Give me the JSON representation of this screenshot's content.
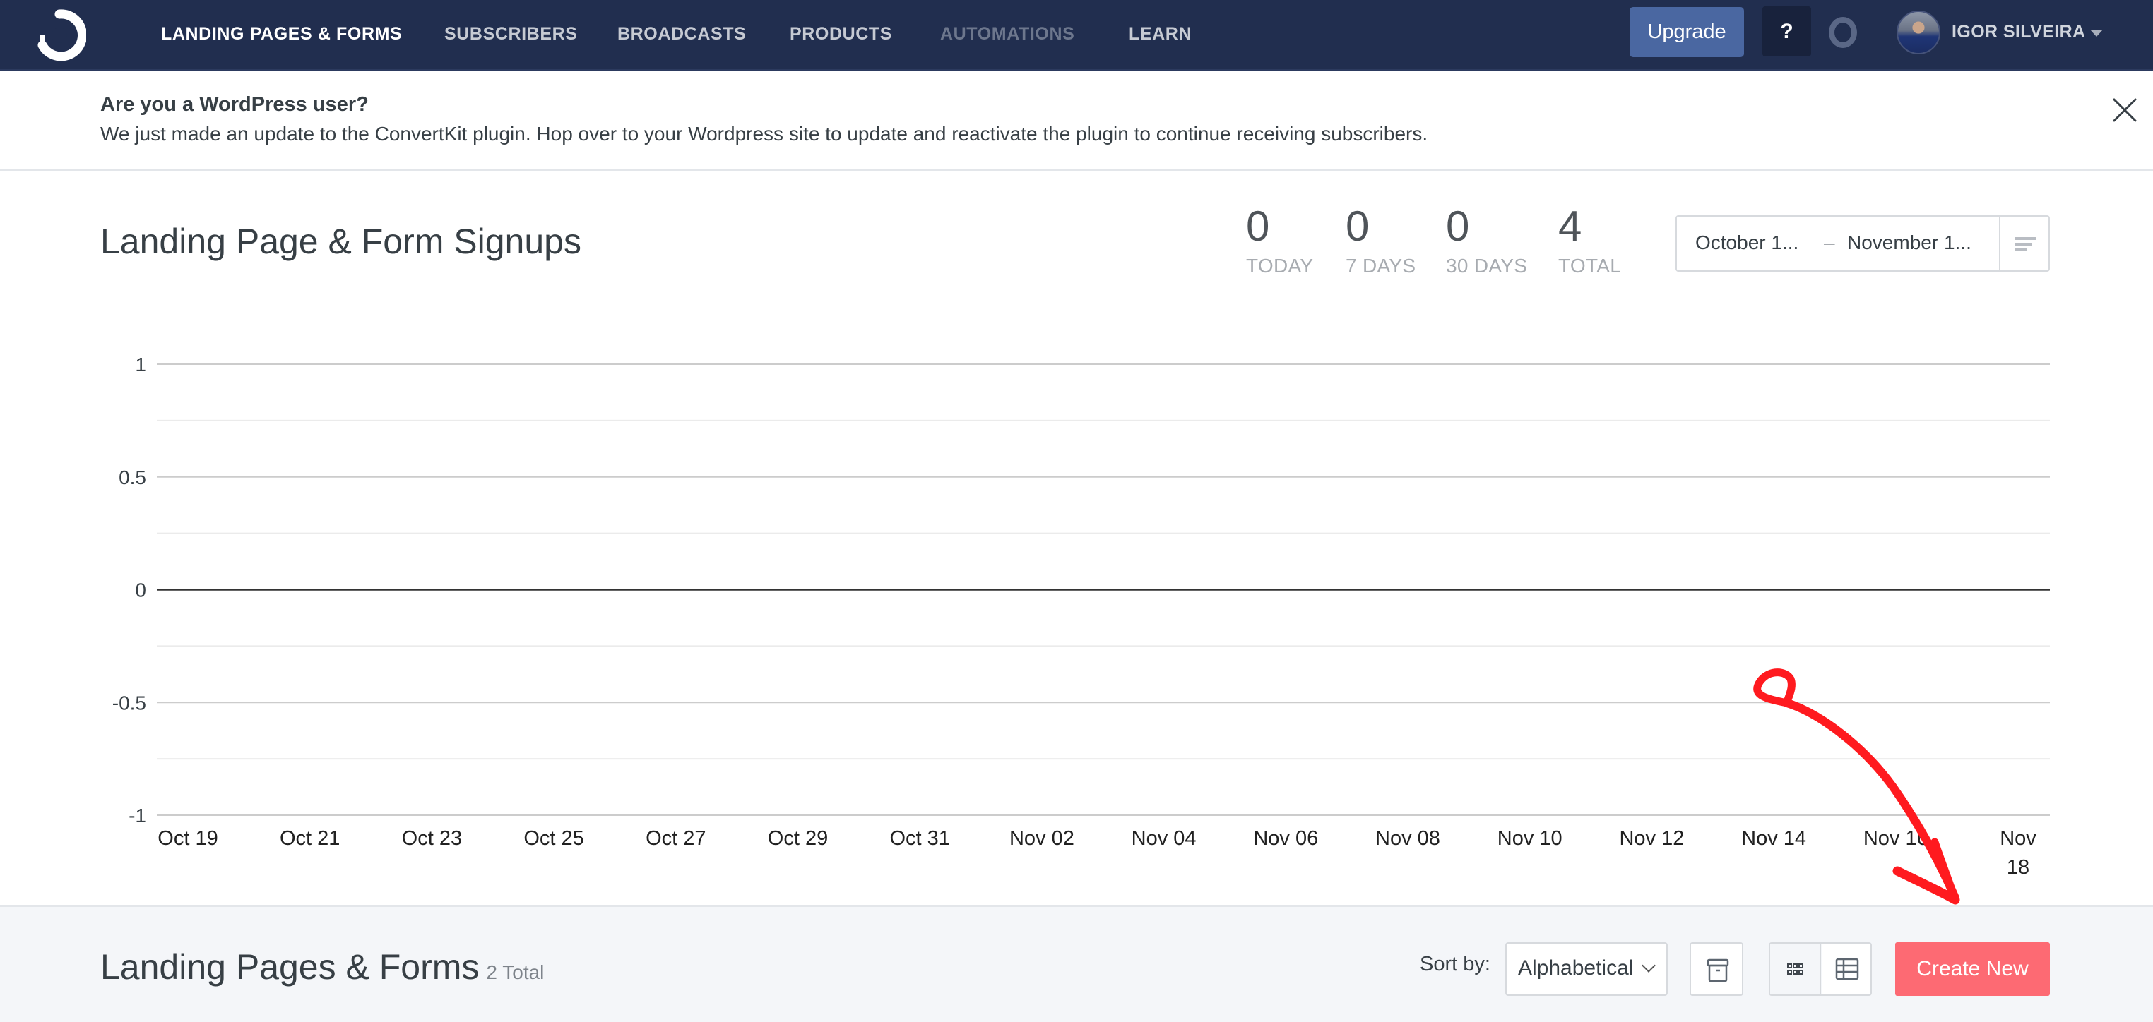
{
  "nav": {
    "logo_icon": "convertkit-logo-icon",
    "items": [
      {
        "label": "LANDING PAGES & FORMS",
        "state": "active"
      },
      {
        "label": "SUBSCRIBERS",
        "state": "normal"
      },
      {
        "label": "BROADCASTS",
        "state": "normal"
      },
      {
        "label": "PRODUCTS",
        "state": "normal"
      },
      {
        "label": "AUTOMATIONS",
        "state": "muted"
      },
      {
        "label": "LEARN",
        "state": "normal"
      }
    ],
    "upgrade_label": "Upgrade",
    "help_label": "?",
    "user_name": "IGOR SILVEIRA"
  },
  "banner": {
    "title": "Are you a WordPress user?",
    "text": "We just made an update to the ConvertKit plugin. Hop over to your Wordpress site to update and reactivate the plugin to continue receiving subscribers."
  },
  "signups": {
    "title": "Landing Page & Form Signups",
    "stats": [
      {
        "value": "0",
        "label": "TODAY"
      },
      {
        "value": "0",
        "label": "7 DAYS"
      },
      {
        "value": "0",
        "label": "30 DAYS"
      },
      {
        "value": "4",
        "label": "TOTAL"
      }
    ],
    "date_range": {
      "start": "October 1...",
      "separator": "–",
      "end": "November 1..."
    }
  },
  "chart_data": {
    "type": "line",
    "title": "",
    "xlabel": "",
    "ylabel": "",
    "ylim": [
      -1,
      1
    ],
    "y_ticks": [
      "1",
      "0.5",
      "0",
      "-0.5",
      "-1"
    ],
    "y_tick_values": [
      1,
      0.5,
      0,
      -0.5,
      -1
    ],
    "minor_gridlines": [
      0.75,
      0.25,
      -0.25,
      -0.75
    ],
    "x_ticks": [
      "Oct 19",
      "Oct 21",
      "Oct 23",
      "Oct 25",
      "Oct 27",
      "Oct 29",
      "Oct 31",
      "Nov 02",
      "Nov 04",
      "Nov 06",
      "Nov 08",
      "Nov 10",
      "Nov 12",
      "Nov 14",
      "Nov 16",
      "Nov 18"
    ],
    "series": [
      {
        "name": "Signups",
        "values": [
          0,
          0,
          0,
          0,
          0,
          0,
          0,
          0,
          0,
          0,
          0,
          0,
          0,
          0,
          0,
          0
        ]
      }
    ],
    "grid": true,
    "legend": "none"
  },
  "list": {
    "title": "Landing Pages & Forms",
    "count": "2 Total",
    "sort_label": "Sort by:",
    "sort_value": "Alphabetical",
    "create_label": "Create New"
  },
  "annotation": {
    "color": "#ff1a1f",
    "description": "hand-drawn red arrow pointing to Create New"
  },
  "colors": {
    "nav_bg": "#212e4f",
    "upgrade": "#4a67a1",
    "create": "#fd6a73",
    "lower_bg": "#f4f6f9"
  }
}
